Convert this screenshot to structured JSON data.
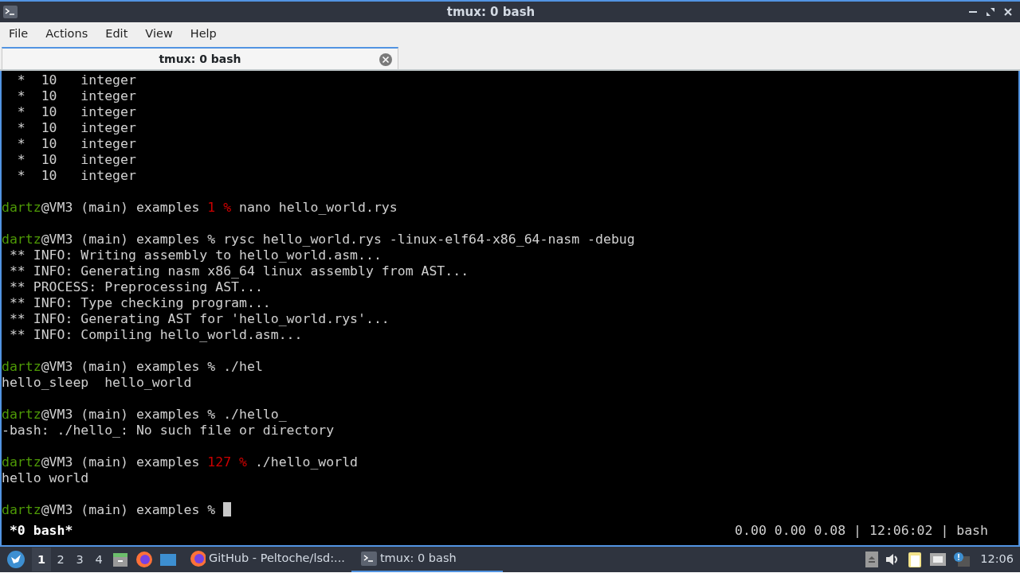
{
  "window": {
    "title": "tmux: 0 bash"
  },
  "menu": [
    "File",
    "Actions",
    "Edit",
    "View",
    "Help"
  ],
  "tabs": [
    {
      "label": "tmux: 0 bash",
      "selected": true
    }
  ],
  "terminal": {
    "lines": [
      {
        "kind": "output",
        "text": "  *  10   integer"
      },
      {
        "kind": "output",
        "text": "  *  10   integer"
      },
      {
        "kind": "output",
        "text": "  *  10   integer"
      },
      {
        "kind": "output",
        "text": "  *  10   integer"
      },
      {
        "kind": "output",
        "text": "  *  10   integer"
      },
      {
        "kind": "output",
        "text": "  *  10   integer"
      },
      {
        "kind": "output",
        "text": "  *  10   integer"
      },
      {
        "kind": "blank"
      },
      {
        "kind": "prompt",
        "user": "dartz",
        "host": "@VM3 (main) examples ",
        "status": "1 %",
        "command": " nano hello_world.rys"
      },
      {
        "kind": "blank"
      },
      {
        "kind": "prompt",
        "user": "dartz",
        "host": "@VM3 (main) examples % ",
        "command": "rysc hello_world.rys -linux-elf64-x86_64-nasm -debug"
      },
      {
        "kind": "output",
        "text": " ** INFO: Writing assembly to hello_world.asm..."
      },
      {
        "kind": "output",
        "text": " ** INFO: Generating nasm x86_64 linux assembly from AST..."
      },
      {
        "kind": "output",
        "text": " ** PROCESS: Preprocessing AST..."
      },
      {
        "kind": "output",
        "text": " ** INFO: Type checking program..."
      },
      {
        "kind": "output",
        "text": " ** INFO: Generating AST for 'hello_world.rys'..."
      },
      {
        "kind": "output",
        "text": " ** INFO: Compiling hello_world.asm..."
      },
      {
        "kind": "blank"
      },
      {
        "kind": "prompt",
        "user": "dartz",
        "host": "@VM3 (main) examples % ",
        "command": "./hel"
      },
      {
        "kind": "output",
        "text": "hello_sleep  hello_world"
      },
      {
        "kind": "blank"
      },
      {
        "kind": "prompt",
        "user": "dartz",
        "host": "@VM3 (main) examples % ",
        "command": "./hello_"
      },
      {
        "kind": "output",
        "text": "-bash: ./hello_: No such file or directory"
      },
      {
        "kind": "blank"
      },
      {
        "kind": "prompt",
        "user": "dartz",
        "host": "@VM3 (main) examples ",
        "status": "127 %",
        "command": " ./hello_world"
      },
      {
        "kind": "output",
        "text": "hello world"
      },
      {
        "kind": "blank"
      },
      {
        "kind": "prompt",
        "user": "dartz",
        "host": "@VM3 (main) examples % ",
        "cursor": true
      }
    ],
    "status_left": " *0 bash*",
    "status_right": "0.00 0.00 0.08 | 12:06:02 | bash"
  },
  "taskbar": {
    "workspaces": [
      {
        "label": "1",
        "selected": true
      },
      {
        "label": "2",
        "selected": false
      },
      {
        "label": "3",
        "selected": false
      },
      {
        "label": "4",
        "selected": false
      }
    ],
    "tasks": [
      {
        "label": "GitHub - Peltoche/lsd:...",
        "kind": "browser",
        "selected": false
      },
      {
        "label": "tmux: 0 bash",
        "kind": "terminal",
        "selected": true
      }
    ],
    "clock": "12:06"
  }
}
